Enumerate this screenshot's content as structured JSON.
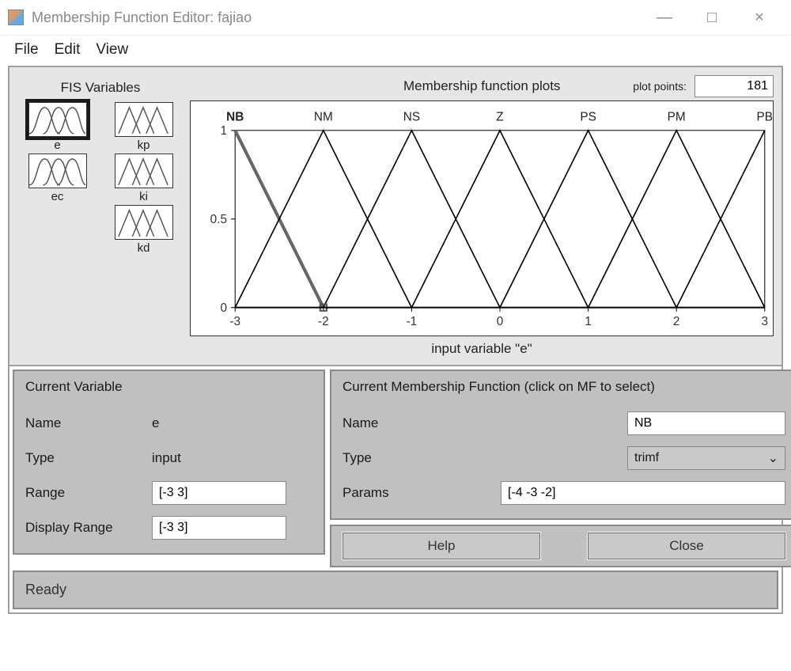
{
  "window": {
    "title": "Membership Function Editor: fajiao"
  },
  "menu": {
    "file": "File",
    "edit": "Edit",
    "view": "View"
  },
  "fis": {
    "title": "FIS Variables",
    "vars": [
      {
        "name": "e",
        "kind": "input",
        "selected": true
      },
      {
        "name": "kp",
        "kind": "output"
      },
      {
        "name": "ec",
        "kind": "input"
      },
      {
        "name": "ki",
        "kind": "output"
      },
      {
        "name": "kd",
        "kind": "output"
      }
    ]
  },
  "plot": {
    "title": "Membership function plots",
    "points_label": "plot points:",
    "points_value": "181",
    "xlabel": "input variable \"e\"",
    "ylabel": "",
    "x_ticks": [
      "-3",
      "-2",
      "-1",
      "0",
      "1",
      "2",
      "3"
    ],
    "y_ticks": [
      "0",
      "0.5",
      "1"
    ],
    "mf_labels": [
      "NB",
      "NM",
      "NS",
      "Z",
      "PS",
      "PM",
      "PB"
    ],
    "selected_mf": "NB"
  },
  "chart_data": {
    "type": "line",
    "title": "Membership function plots",
    "xlabel": "input variable \"e\"",
    "ylabel": "",
    "xlim": [
      -3,
      3
    ],
    "ylim": [
      0,
      1
    ],
    "categories": [
      "NB",
      "NM",
      "NS",
      "Z",
      "PS",
      "PM",
      "PB"
    ],
    "series": [
      {
        "name": "NB",
        "type": "trimf",
        "params": [
          -4,
          -3,
          -2
        ],
        "x": [
          -3,
          -2
        ],
        "y": [
          1,
          0
        ],
        "selected": true
      },
      {
        "name": "NM",
        "type": "trimf",
        "params": [
          -3,
          -2,
          -1
        ],
        "x": [
          -3,
          -2,
          -1
        ],
        "y": [
          0,
          1,
          0
        ]
      },
      {
        "name": "NS",
        "type": "trimf",
        "params": [
          -2,
          -1,
          0
        ],
        "x": [
          -2,
          -1,
          0
        ],
        "y": [
          0,
          1,
          0
        ]
      },
      {
        "name": "Z",
        "type": "trimf",
        "params": [
          -1,
          0,
          1
        ],
        "x": [
          -1,
          0,
          1
        ],
        "y": [
          0,
          1,
          0
        ]
      },
      {
        "name": "PS",
        "type": "trimf",
        "params": [
          0,
          1,
          2
        ],
        "x": [
          0,
          1,
          2
        ],
        "y": [
          0,
          1,
          0
        ]
      },
      {
        "name": "PM",
        "type": "trimf",
        "params": [
          1,
          2,
          3
        ],
        "x": [
          1,
          2,
          3
        ],
        "y": [
          0,
          1,
          0
        ]
      },
      {
        "name": "PB",
        "type": "trimf",
        "params": [
          2,
          3,
          4
        ],
        "x": [
          2,
          3
        ],
        "y": [
          0,
          1
        ]
      }
    ]
  },
  "current_variable": {
    "header": "Current Variable",
    "name_label": "Name",
    "name_value": "e",
    "type_label": "Type",
    "type_value": "input",
    "range_label": "Range",
    "range_value": "[-3 3]",
    "display_range_label": "Display Range",
    "display_range_value": "[-3 3]"
  },
  "current_mf": {
    "header": "Current Membership Function (click on MF to select)",
    "name_label": "Name",
    "name_value": "NB",
    "type_label": "Type",
    "type_value": "trimf",
    "params_label": "Params",
    "params_value": "[-4 -3 -2]"
  },
  "buttons": {
    "help": "Help",
    "close": "Close"
  },
  "status": "Ready"
}
